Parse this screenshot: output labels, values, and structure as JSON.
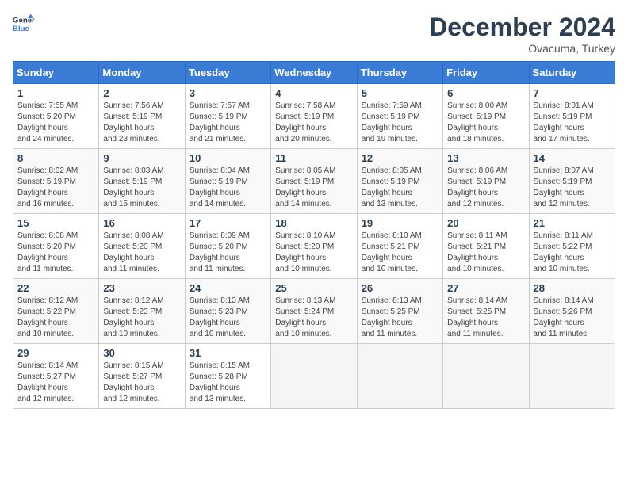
{
  "header": {
    "logo_line1": "General",
    "logo_line2": "Blue",
    "month": "December 2024",
    "location": "Ovacuma, Turkey"
  },
  "days_of_week": [
    "Sunday",
    "Monday",
    "Tuesday",
    "Wednesday",
    "Thursday",
    "Friday",
    "Saturday"
  ],
  "weeks": [
    [
      {
        "day": 1,
        "sunrise": "7:55 AM",
        "sunset": "5:20 PM",
        "daylight": "9 hours and 24 minutes."
      },
      {
        "day": 2,
        "sunrise": "7:56 AM",
        "sunset": "5:19 PM",
        "daylight": "9 hours and 23 minutes."
      },
      {
        "day": 3,
        "sunrise": "7:57 AM",
        "sunset": "5:19 PM",
        "daylight": "9 hours and 21 minutes."
      },
      {
        "day": 4,
        "sunrise": "7:58 AM",
        "sunset": "5:19 PM",
        "daylight": "9 hours and 20 minutes."
      },
      {
        "day": 5,
        "sunrise": "7:59 AM",
        "sunset": "5:19 PM",
        "daylight": "9 hours and 19 minutes."
      },
      {
        "day": 6,
        "sunrise": "8:00 AM",
        "sunset": "5:19 PM",
        "daylight": "9 hours and 18 minutes."
      },
      {
        "day": 7,
        "sunrise": "8:01 AM",
        "sunset": "5:19 PM",
        "daylight": "9 hours and 17 minutes."
      }
    ],
    [
      {
        "day": 8,
        "sunrise": "8:02 AM",
        "sunset": "5:19 PM",
        "daylight": "9 hours and 16 minutes."
      },
      {
        "day": 9,
        "sunrise": "8:03 AM",
        "sunset": "5:19 PM",
        "daylight": "9 hours and 15 minutes."
      },
      {
        "day": 10,
        "sunrise": "8:04 AM",
        "sunset": "5:19 PM",
        "daylight": "9 hours and 14 minutes."
      },
      {
        "day": 11,
        "sunrise": "8:05 AM",
        "sunset": "5:19 PM",
        "daylight": "9 hours and 14 minutes."
      },
      {
        "day": 12,
        "sunrise": "8:05 AM",
        "sunset": "5:19 PM",
        "daylight": "9 hours and 13 minutes."
      },
      {
        "day": 13,
        "sunrise": "8:06 AM",
        "sunset": "5:19 PM",
        "daylight": "9 hours and 12 minutes."
      },
      {
        "day": 14,
        "sunrise": "8:07 AM",
        "sunset": "5:19 PM",
        "daylight": "9 hours and 12 minutes."
      }
    ],
    [
      {
        "day": 15,
        "sunrise": "8:08 AM",
        "sunset": "5:20 PM",
        "daylight": "9 hours and 11 minutes."
      },
      {
        "day": 16,
        "sunrise": "8:08 AM",
        "sunset": "5:20 PM",
        "daylight": "9 hours and 11 minutes."
      },
      {
        "day": 17,
        "sunrise": "8:09 AM",
        "sunset": "5:20 PM",
        "daylight": "9 hours and 11 minutes."
      },
      {
        "day": 18,
        "sunrise": "8:10 AM",
        "sunset": "5:20 PM",
        "daylight": "9 hours and 10 minutes."
      },
      {
        "day": 19,
        "sunrise": "8:10 AM",
        "sunset": "5:21 PM",
        "daylight": "9 hours and 10 minutes."
      },
      {
        "day": 20,
        "sunrise": "8:11 AM",
        "sunset": "5:21 PM",
        "daylight": "9 hours and 10 minutes."
      },
      {
        "day": 21,
        "sunrise": "8:11 AM",
        "sunset": "5:22 PM",
        "daylight": "9 hours and 10 minutes."
      }
    ],
    [
      {
        "day": 22,
        "sunrise": "8:12 AM",
        "sunset": "5:22 PM",
        "daylight": "9 hours and 10 minutes."
      },
      {
        "day": 23,
        "sunrise": "8:12 AM",
        "sunset": "5:23 PM",
        "daylight": "9 hours and 10 minutes."
      },
      {
        "day": 24,
        "sunrise": "8:13 AM",
        "sunset": "5:23 PM",
        "daylight": "9 hours and 10 minutes."
      },
      {
        "day": 25,
        "sunrise": "8:13 AM",
        "sunset": "5:24 PM",
        "daylight": "9 hours and 10 minutes."
      },
      {
        "day": 26,
        "sunrise": "8:13 AM",
        "sunset": "5:25 PM",
        "daylight": "9 hours and 11 minutes."
      },
      {
        "day": 27,
        "sunrise": "8:14 AM",
        "sunset": "5:25 PM",
        "daylight": "9 hours and 11 minutes."
      },
      {
        "day": 28,
        "sunrise": "8:14 AM",
        "sunset": "5:26 PM",
        "daylight": "9 hours and 11 minutes."
      }
    ],
    [
      {
        "day": 29,
        "sunrise": "8:14 AM",
        "sunset": "5:27 PM",
        "daylight": "9 hours and 12 minutes."
      },
      {
        "day": 30,
        "sunrise": "8:15 AM",
        "sunset": "5:27 PM",
        "daylight": "9 hours and 12 minutes."
      },
      {
        "day": 31,
        "sunrise": "8:15 AM",
        "sunset": "5:28 PM",
        "daylight": "9 hours and 13 minutes."
      },
      null,
      null,
      null,
      null
    ]
  ]
}
